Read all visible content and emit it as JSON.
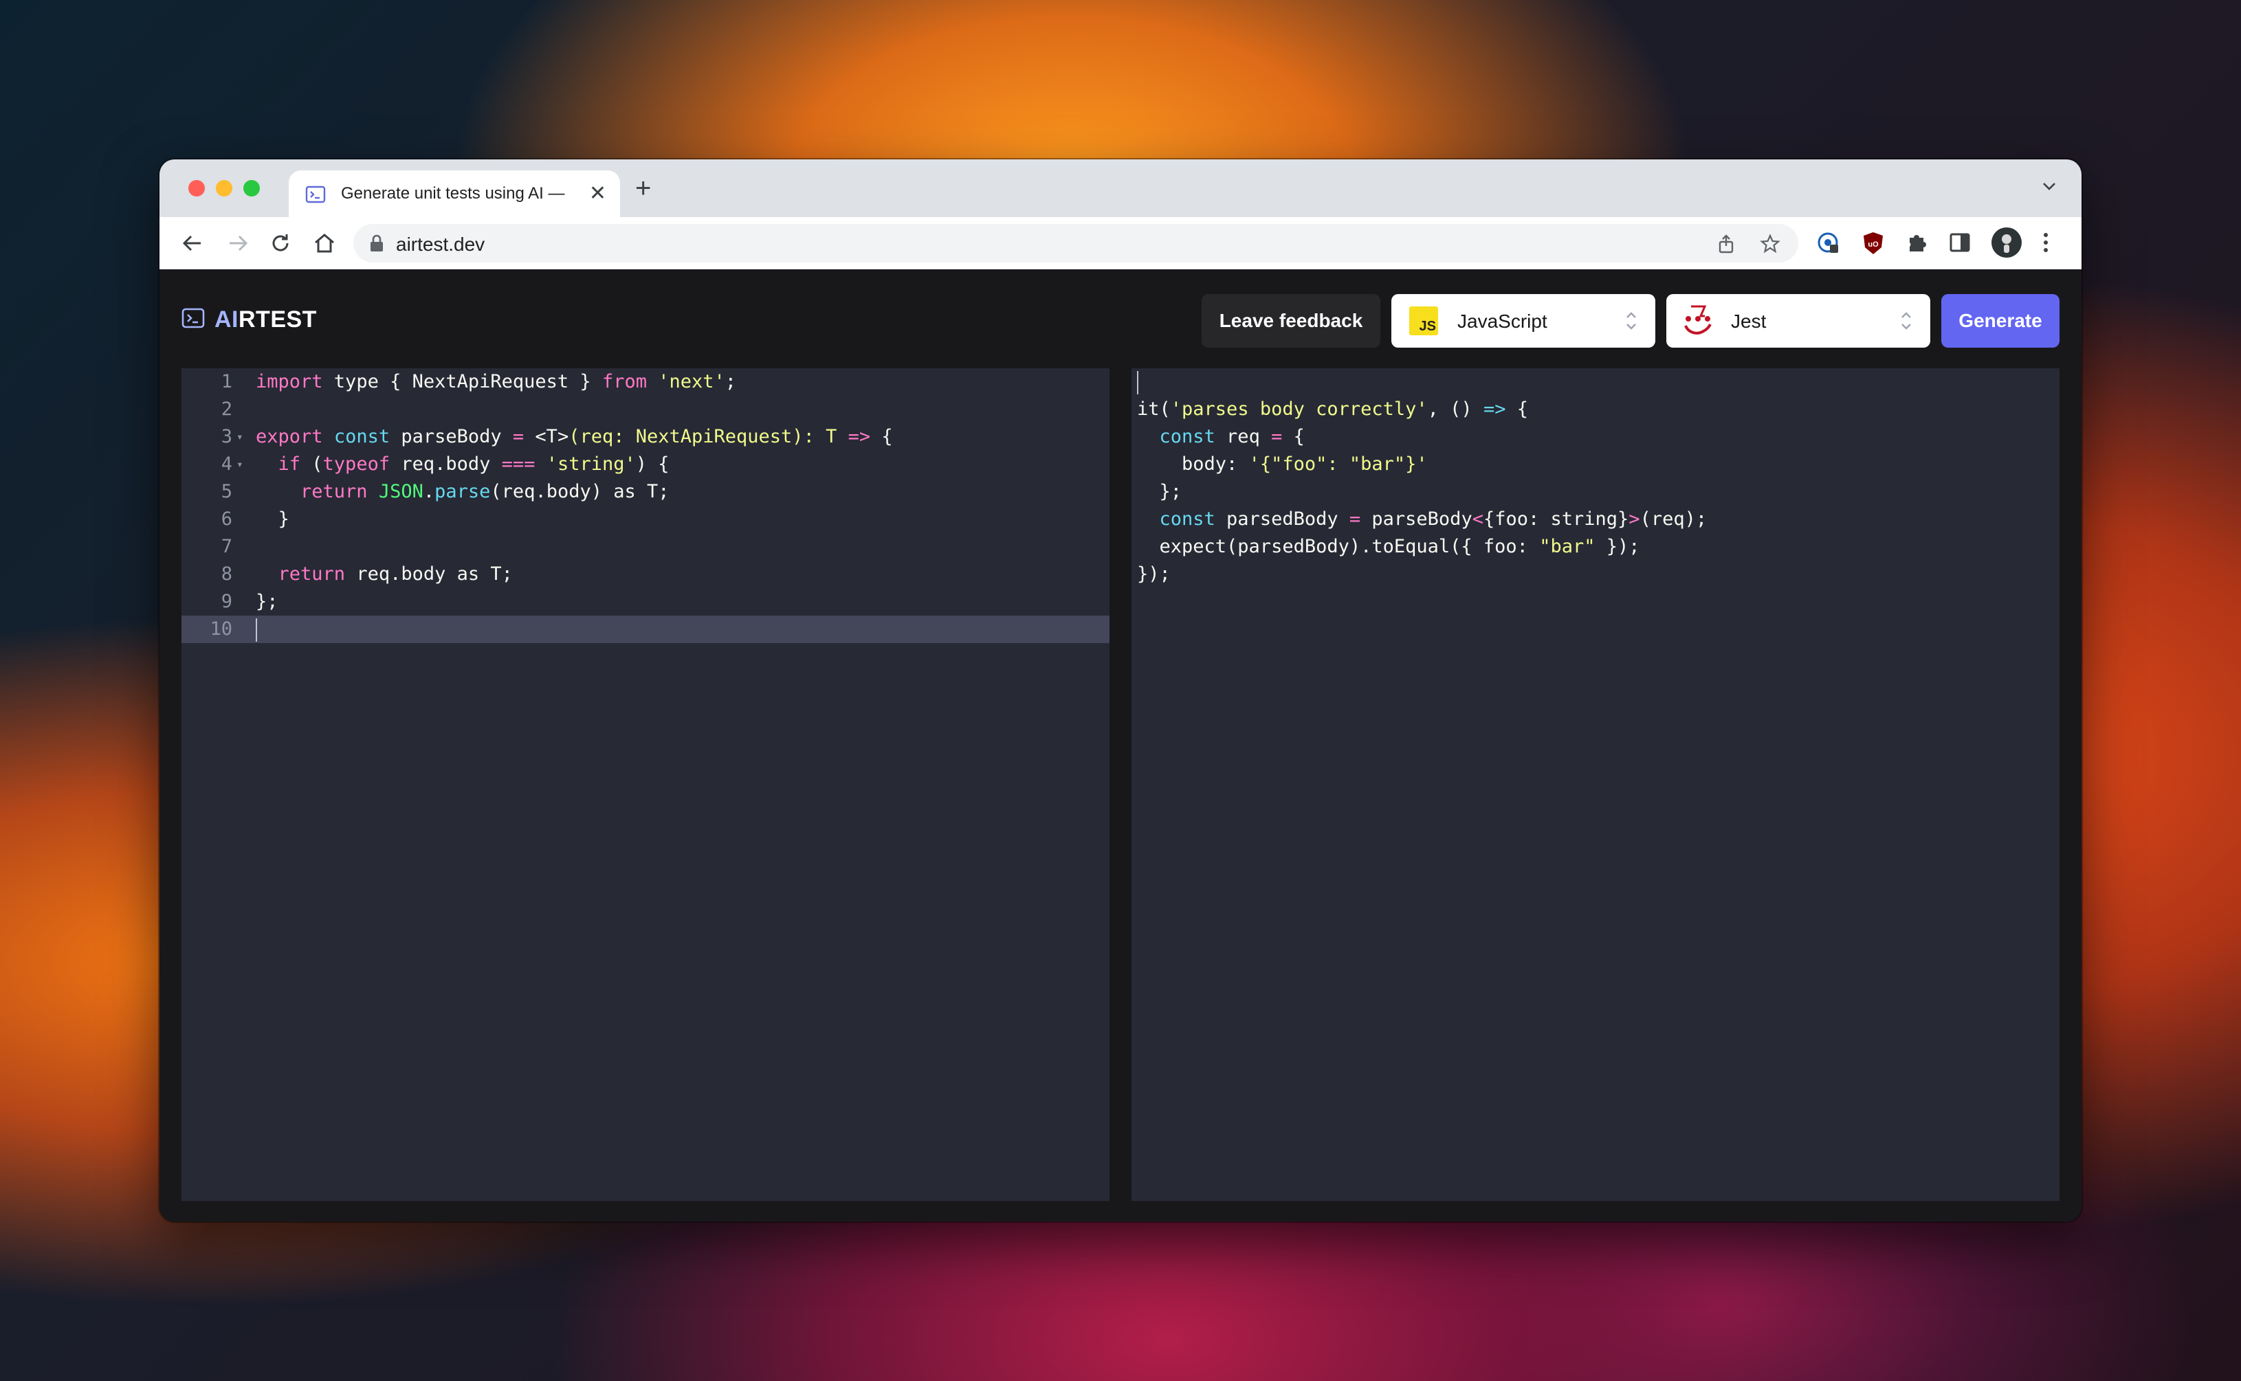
{
  "browser": {
    "tab_title": "Generate unit tests using AI —",
    "url": "airtest.dev"
  },
  "app": {
    "logo_ai": "AI",
    "logo_rest": "RTEST",
    "feedback_label": "Leave feedback",
    "language_select": "JavaScript",
    "js_badge": "JS",
    "framework_select": "Jest",
    "generate_label": "Generate"
  },
  "input_code": {
    "line_numbers": [
      "1",
      "2",
      "3",
      "4",
      "5",
      "6",
      "7",
      "8",
      "9",
      "10"
    ],
    "lines": [
      [
        {
          "t": "import",
          "c": "kw"
        },
        {
          "t": " type { NextApiRequest } ",
          "c": "pl"
        },
        {
          "t": "from",
          "c": "kw"
        },
        {
          "t": " ",
          "c": "pl"
        },
        {
          "t": "'next'",
          "c": "str"
        },
        {
          "t": ";",
          "c": "pl"
        }
      ],
      [],
      [
        {
          "t": "export",
          "c": "kw"
        },
        {
          "t": " ",
          "c": "pl"
        },
        {
          "t": "const",
          "c": "kw2"
        },
        {
          "t": " parseBody ",
          "c": "pl"
        },
        {
          "t": "=",
          "c": "kw"
        },
        {
          "t": " <T>",
          "c": "pl"
        },
        {
          "t": "(req: NextApiRequest): T",
          "c": "str"
        },
        {
          "t": " ",
          "c": "pl"
        },
        {
          "t": "=>",
          "c": "kw"
        },
        {
          "t": " {",
          "c": "pl"
        }
      ],
      [
        {
          "t": "  ",
          "c": "pl"
        },
        {
          "t": "if",
          "c": "kw"
        },
        {
          "t": " (",
          "c": "pl"
        },
        {
          "t": "typeof",
          "c": "kw"
        },
        {
          "t": " req.body ",
          "c": "pl"
        },
        {
          "t": "===",
          "c": "kw"
        },
        {
          "t": " ",
          "c": "pl"
        },
        {
          "t": "'string'",
          "c": "str"
        },
        {
          "t": ") {",
          "c": "pl"
        }
      ],
      [
        {
          "t": "    ",
          "c": "pl"
        },
        {
          "t": "return",
          "c": "kw"
        },
        {
          "t": " ",
          "c": "pl"
        },
        {
          "t": "JSON",
          "c": "fn"
        },
        {
          "t": ".",
          "c": "pl"
        },
        {
          "t": "parse",
          "c": "kw2"
        },
        {
          "t": "(req.body) as T;",
          "c": "pl"
        }
      ],
      [
        {
          "t": "  }",
          "c": "pl"
        }
      ],
      [],
      [
        {
          "t": "  ",
          "c": "pl"
        },
        {
          "t": "return",
          "c": "kw"
        },
        {
          "t": " req.body as T;",
          "c": "pl"
        }
      ],
      [
        {
          "t": "};",
          "c": "pl"
        }
      ],
      []
    ]
  },
  "output_code": {
    "lines": [
      [],
      [
        {
          "t": "it(",
          "c": "pl"
        },
        {
          "t": "'parses body correctly'",
          "c": "str"
        },
        {
          "t": ", () ",
          "c": "pl"
        },
        {
          "t": "=>",
          "c": "kw2"
        },
        {
          "t": " {",
          "c": "pl"
        }
      ],
      [
        {
          "t": "  ",
          "c": "pl"
        },
        {
          "t": "const",
          "c": "kw2"
        },
        {
          "t": " req ",
          "c": "pl"
        },
        {
          "t": "=",
          "c": "kw"
        },
        {
          "t": " {",
          "c": "pl"
        }
      ],
      [
        {
          "t": "    body: ",
          "c": "pl"
        },
        {
          "t": "'{\"foo\": \"bar\"}'",
          "c": "str"
        }
      ],
      [
        {
          "t": "  };",
          "c": "pl"
        }
      ],
      [
        {
          "t": "  ",
          "c": "pl"
        },
        {
          "t": "const",
          "c": "kw2"
        },
        {
          "t": " parsedBody ",
          "c": "pl"
        },
        {
          "t": "=",
          "c": "kw"
        },
        {
          "t": " parseBody",
          "c": "pl"
        },
        {
          "t": "<",
          "c": "kw"
        },
        {
          "t": "{foo: string}",
          "c": "pl"
        },
        {
          "t": ">",
          "c": "kw"
        },
        {
          "t": "(req);",
          "c": "pl"
        }
      ],
      [
        {
          "t": "  expect(parsedBody).toEqual({ foo: ",
          "c": "pl"
        },
        {
          "t": "\"bar\"",
          "c": "str"
        },
        {
          "t": " });",
          "c": "pl"
        }
      ],
      [
        {
          "t": "});",
          "c": "pl"
        }
      ]
    ]
  },
  "colors": {
    "accent": "#6366f1",
    "editor_bg": "#272935",
    "app_bg": "#18181b"
  },
  "icons": [
    "terminal-icon",
    "back-arrow-icon",
    "forward-arrow-icon",
    "reload-icon",
    "home-icon",
    "lock-icon",
    "share-icon",
    "star-icon",
    "password-manager-icon",
    "ublock-icon",
    "extensions-puzzle-icon",
    "side-panel-icon",
    "avatar",
    "kebab-menu-icon",
    "chevron-updown-icon",
    "jest-logo-icon"
  ]
}
